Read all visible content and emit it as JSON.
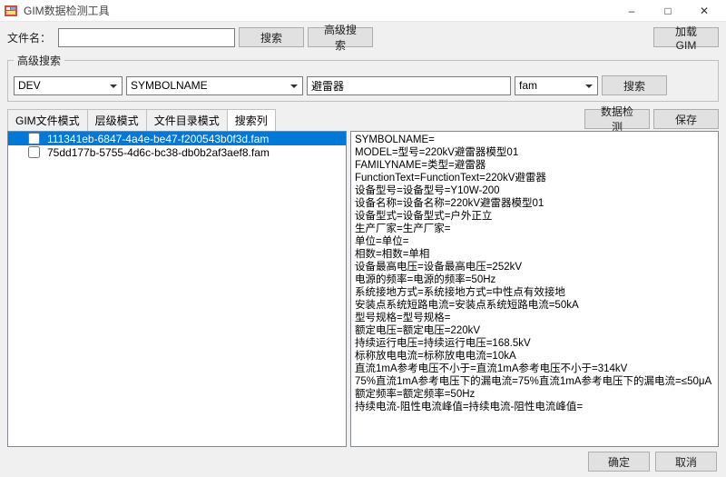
{
  "window": {
    "title": "GIM数据检测工具",
    "minimize": "–",
    "maximize": "□",
    "close": "✕"
  },
  "top": {
    "filename_label": "文件名：",
    "filename_value": "",
    "search_btn": "搜索",
    "adv_search_btn": "高级搜索",
    "load_gim_btn": "加载GIM"
  },
  "adv": {
    "legend": "高级搜索",
    "dropdown1": "DEV",
    "dropdown2": "SYMBOLNAME",
    "textbox_value": "避雷器",
    "dropdown3": "fam",
    "search_btn": "搜索"
  },
  "tabs": {
    "t1": "GIM文件模式",
    "t2": "层级模式",
    "t3": "文件目录模式",
    "t4": "搜索列"
  },
  "right_actions": {
    "detect": "数据检测",
    "save": "保存"
  },
  "tree": {
    "row1": "111341eb-6847-4a4e-be47-f200543b0f3d.fam",
    "row2": "75dd177b-5755-4d6c-bc38-db0b2af3aef8.fam"
  },
  "details": [
    "SYMBOLNAME=",
    "MODEL=型号=220kV避雷器模型01",
    "FAMILYNAME=类型=避雷器",
    "FunctionText=FunctionText=220kV避雷器",
    "设备型号=设备型号=Y10W-200",
    "设备名称=设备名称=220kV避雷器模型01",
    "设备型式=设备型式=户外正立",
    "生产厂家=生产厂家=",
    "单位=单位=",
    "相数=相数=单相",
    "设备最高电压=设备最高电压=252kV",
    "电源的频率=电源的频率=50Hz",
    "系统接地方式=系统接地方式=中性点有效接地",
    "安装点系统短路电流=安装点系统短路电流=50kA",
    "型号规格=型号规格=",
    "额定电压=额定电压=220kV",
    "持续运行电压=持续运行电压=168.5kV",
    "标称放电电流=标称放电电流=10kA",
    "直流1mA参考电压不小于=直流1mA参考电压不小于=314kV",
    "75%直流1mA参考电压下的漏电流=75%直流1mA参考电压下的漏电流=≤50μA",
    "额定频率=额定频率=50Hz",
    "持续电流-阻性电流峰值=持续电流-阻性电流峰值="
  ],
  "footer": {
    "ok": "确定",
    "cancel": "取消"
  }
}
